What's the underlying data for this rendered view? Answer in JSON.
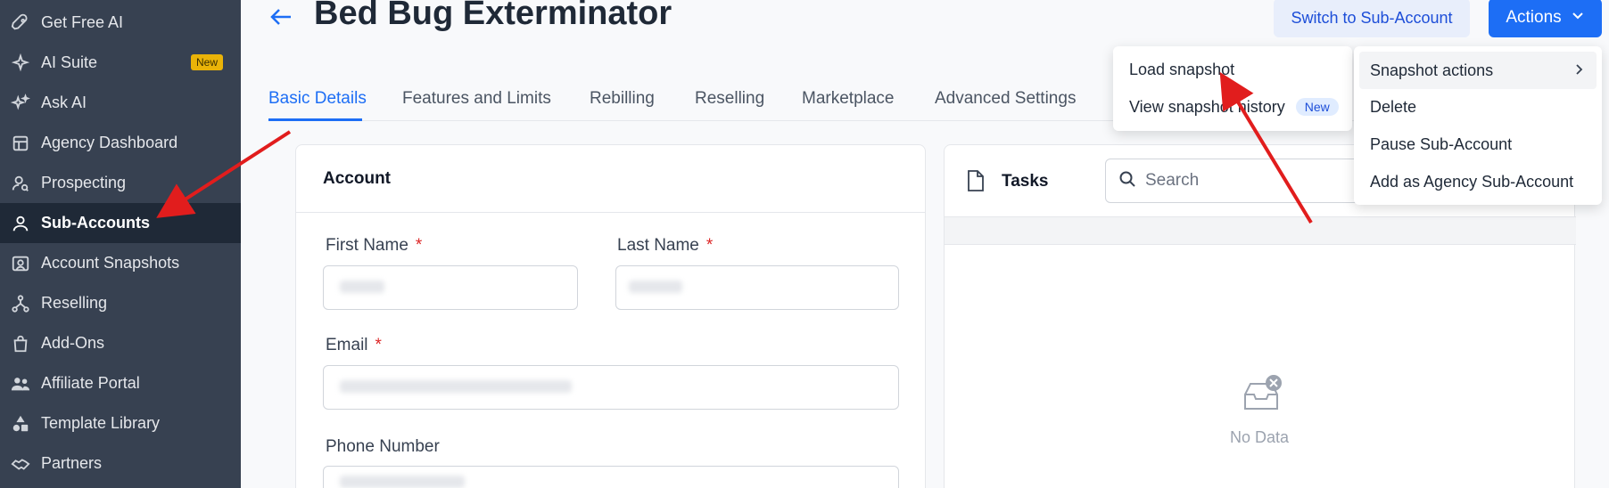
{
  "sidebar": {
    "items": [
      {
        "label": "Get Free AI",
        "icon": "rocket-icon"
      },
      {
        "label": "AI Suite",
        "icon": "sparkle-icon",
        "badge": "New"
      },
      {
        "label": "Ask AI",
        "icon": "stars-icon"
      },
      {
        "label": "Agency Dashboard",
        "icon": "dashboard-icon"
      },
      {
        "label": "Prospecting",
        "icon": "person-search-icon"
      },
      {
        "label": "Sub-Accounts",
        "icon": "user-icon",
        "active": true
      },
      {
        "label": "Account Snapshots",
        "icon": "snapshot-icon"
      },
      {
        "label": "Reselling",
        "icon": "network-icon"
      },
      {
        "label": "Add-Ons",
        "icon": "bag-icon"
      },
      {
        "label": "Affiliate Portal",
        "icon": "users-icon"
      },
      {
        "label": "Template Library",
        "icon": "shapes-icon"
      },
      {
        "label": "Partners",
        "icon": "handshake-icon"
      }
    ]
  },
  "header": {
    "title": "Bed Bug Exterminator",
    "switch_label": "Switch to Sub-Account",
    "actions_label": "Actions"
  },
  "tabs": [
    {
      "label": "Basic Details",
      "active": true
    },
    {
      "label": "Features and Limits"
    },
    {
      "label": "Rebilling"
    },
    {
      "label": "Reselling"
    },
    {
      "label": "Marketplace"
    },
    {
      "label": "Advanced Settings"
    }
  ],
  "account": {
    "title": "Account",
    "first_name_label": "First Name",
    "last_name_label": "Last Name",
    "email_label": "Email",
    "phone_label": "Phone Number",
    "required_mark": "*"
  },
  "tasks": {
    "title": "Tasks",
    "search_placeholder": "Search",
    "empty_text": "No Data"
  },
  "actions_menu": {
    "items": [
      "Snapshot actions",
      "Delete",
      "Pause Sub-Account",
      "Add as Agency Sub-Account"
    ]
  },
  "snapshot_menu": {
    "items": [
      "Load snapshot",
      "View snapshot history"
    ],
    "history_badge": "New"
  },
  "colors": {
    "sidebar_bg": "#374151",
    "sidebar_active": "#1f2937",
    "accent": "#1d6ef5",
    "badge_yellow": "#eab308",
    "annotation_red": "#e11d1d"
  }
}
